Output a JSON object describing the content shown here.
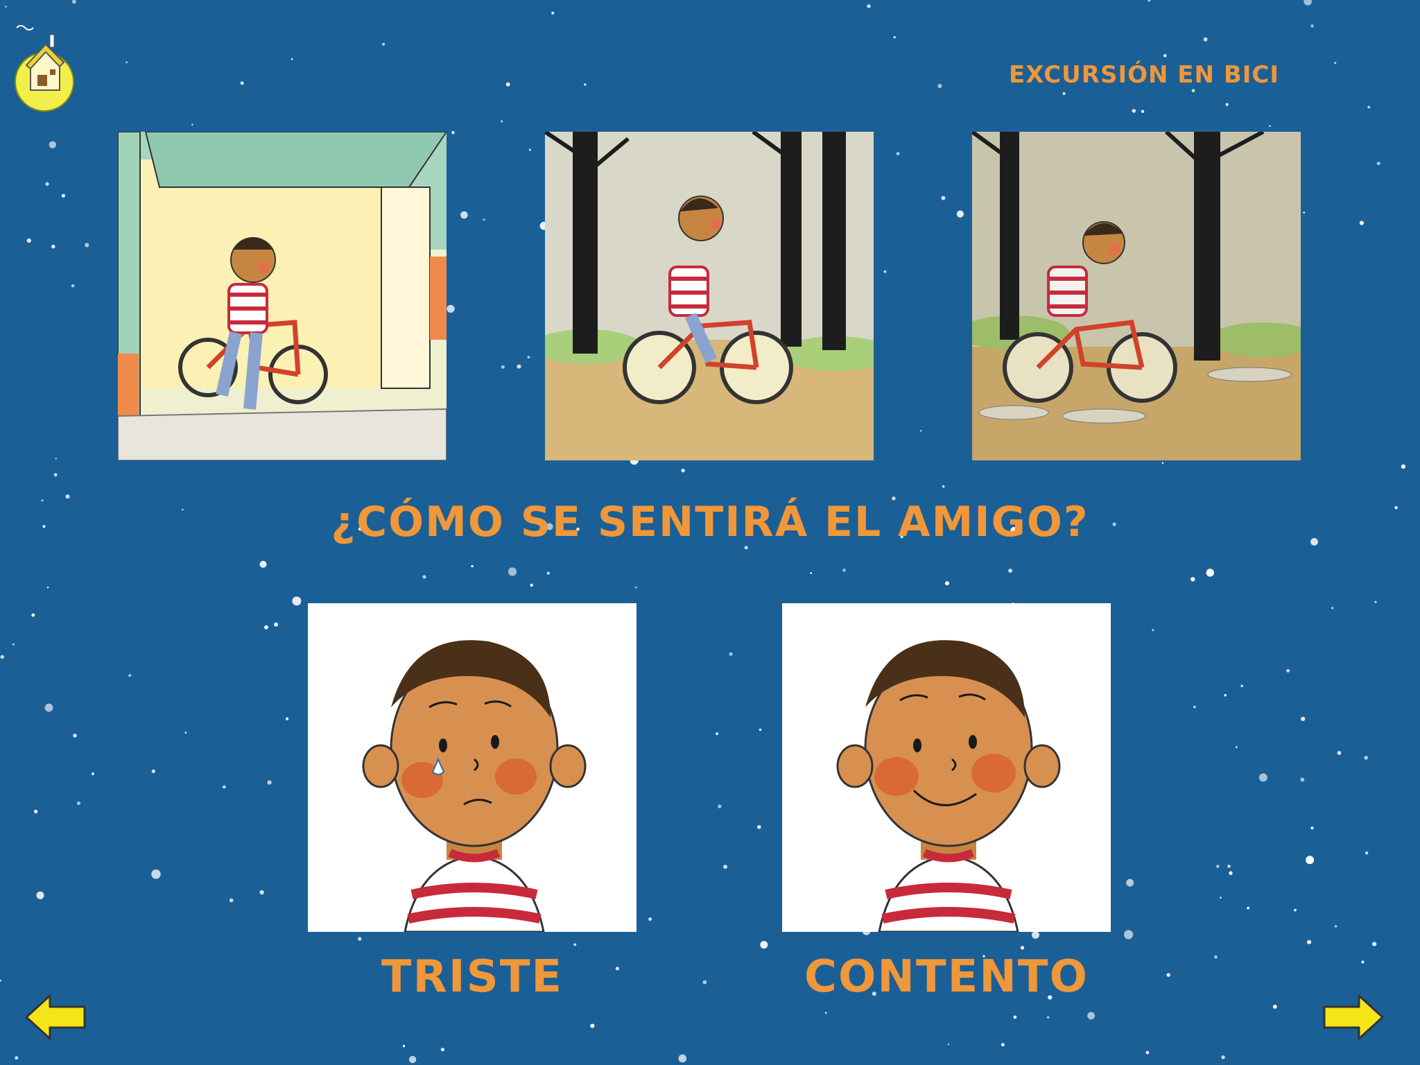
{
  "header": {
    "title": "EXCURSIÓN EN BICI"
  },
  "icons": {
    "home": "home-icon",
    "prev": "arrow-left-icon",
    "next": "arrow-right-icon"
  },
  "story": {
    "panels": [
      {
        "scene": "boy-takes-bike-from-garage"
      },
      {
        "scene": "boy-rides-bike-in-rainy-forest"
      },
      {
        "scene": "boy-rides-through-puddles-in-heavy-rain"
      }
    ]
  },
  "question": "¿CÓMO SE SENTIRÁ EL AMIGO?",
  "choices": [
    {
      "label": "TRISTE"
    },
    {
      "label": "CONTENTO"
    }
  ],
  "colors": {
    "background": "#1b5f97",
    "accent": "#f0973a",
    "arrow": "#f4e51a",
    "home_moon": "#f2ee4a"
  }
}
